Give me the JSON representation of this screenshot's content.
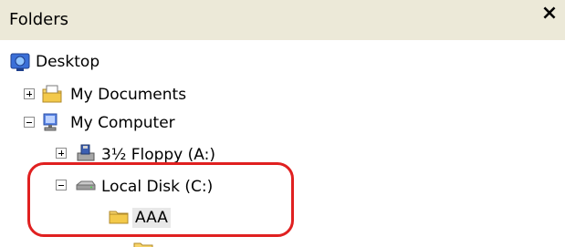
{
  "panel": {
    "title": "Folders",
    "close_glyph": "×"
  },
  "tree": [
    {
      "label": "Desktop",
      "icon": "desktop-icon",
      "expander": "none"
    },
    {
      "label": "My Documents",
      "icon": "my-documents-icon",
      "expander": "plus"
    },
    {
      "label": "My Computer",
      "icon": "my-computer-icon",
      "expander": "minus"
    },
    {
      "label": "3½ Floppy (A:)",
      "icon": "floppy-drive-icon",
      "expander": "plus"
    },
    {
      "label": "Local Disk (C:)",
      "icon": "local-disk-icon",
      "expander": "minus"
    },
    {
      "label": "AAA",
      "icon": "folder-icon",
      "expander": "none",
      "selected": true
    }
  ],
  "annotation": {
    "color": "#e02020"
  }
}
